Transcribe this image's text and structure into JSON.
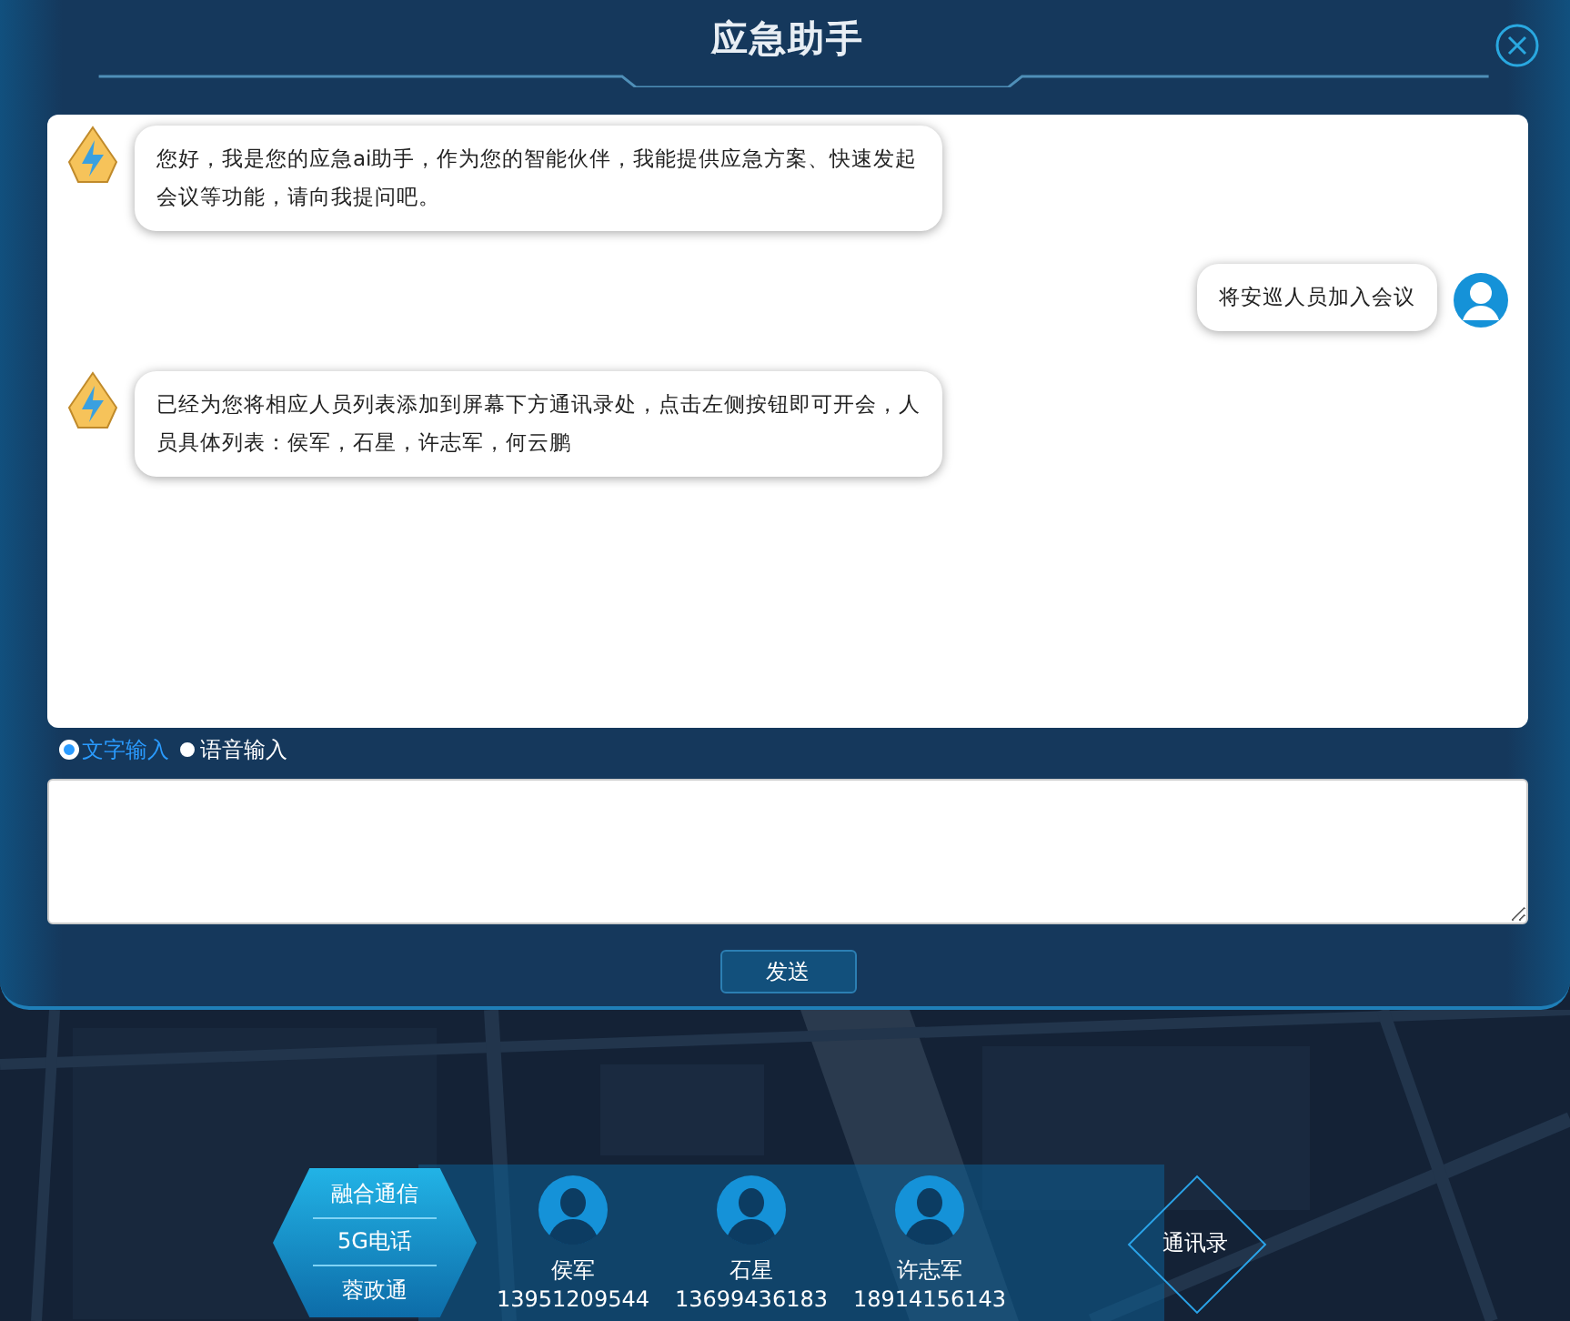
{
  "dialog": {
    "title": "应急助手"
  },
  "messages": [
    {
      "kind": "bot",
      "text": "您好，我是您的应急ai助手，作为您的智能伙伴，我能提供应急方案、快速发起会议等功能，请向我提问吧。"
    },
    {
      "kind": "user",
      "text": "将安巡人员加入会议"
    },
    {
      "kind": "bot",
      "text": "已经为您将相应人员列表添加到屏幕下方通讯录处，点击左侧按钮即可开会，人员具体列表：侯军，石星，许志军，何云鹏"
    }
  ],
  "input_modes": [
    {
      "label": "文字输入",
      "selected": true
    },
    {
      "label": "语音输入",
      "selected": false
    }
  ],
  "send_button": "发送",
  "menu": [
    "融合通信",
    "5G电话",
    "蓉政通"
  ],
  "contacts": [
    {
      "name": "侯军",
      "phone": "13951209544"
    },
    {
      "name": "石星",
      "phone": "13699436183"
    },
    {
      "name": "许志军",
      "phone": "18914156143"
    }
  ],
  "directory_button": "通讯录"
}
